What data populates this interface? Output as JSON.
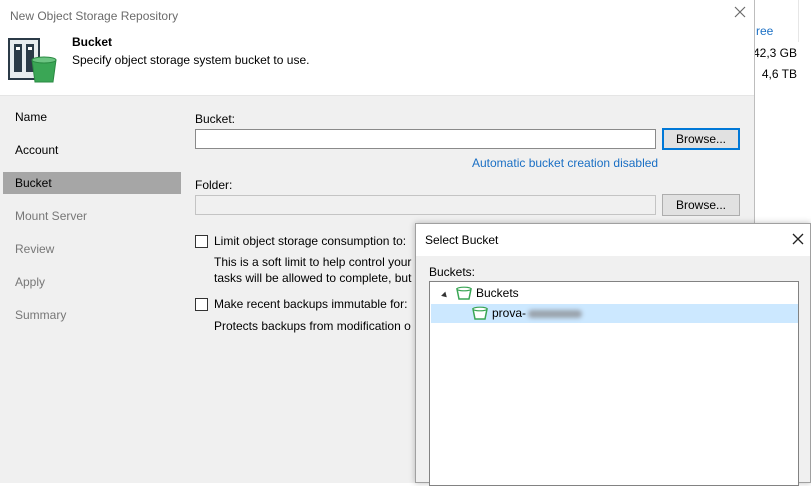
{
  "background": {
    "link_text": "ree",
    "values": [
      "42,3 GB",
      "4,6 TB"
    ]
  },
  "wizard": {
    "title": "New Object Storage Repository",
    "header": {
      "title": "Bucket",
      "subtitle": "Specify object storage system bucket to use."
    },
    "nav": [
      {
        "label": "Name",
        "state": "normal"
      },
      {
        "label": "Account",
        "state": "normal"
      },
      {
        "label": "Bucket",
        "state": "active"
      },
      {
        "label": "Mount Server",
        "state": "dim"
      },
      {
        "label": "Review",
        "state": "dim"
      },
      {
        "label": "Apply",
        "state": "dim"
      },
      {
        "label": "Summary",
        "state": "dim"
      }
    ],
    "bucket_label": "Bucket:",
    "bucket_value": "",
    "browse_label": "Browse...",
    "auto_bucket_link": "Automatic bucket creation disabled",
    "folder_label": "Folder:",
    "folder_value": "",
    "limit_label": "Limit object storage consumption to:",
    "limit_desc_1": "This is a soft limit to help control your",
    "limit_desc_2": "tasks will be allowed to complete, but",
    "immutable_label": "Make recent backups immutable for:",
    "immutable_desc": "Protects backups from modification o"
  },
  "dialog": {
    "title": "Select Bucket",
    "list_label": "Buckets:",
    "root": "Buckets",
    "items": [
      {
        "name": "prova-",
        "selected": true
      }
    ]
  },
  "colors": {
    "accent": "#0078d7",
    "link": "#1a6fc4",
    "selection": "#cce8ff",
    "bucket_green": "#3aa655"
  }
}
